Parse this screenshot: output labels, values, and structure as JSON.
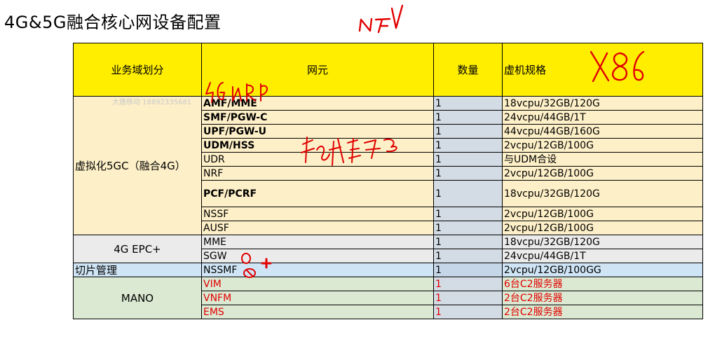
{
  "title": "4G&5G融合核心网设备配置",
  "watermark": "大唐移动 18892335681",
  "handwriting": {
    "top": "NFV",
    "header": "X86",
    "over_element": "5G NR",
    "over_table": "软件功能"
  },
  "table": {
    "headers": {
      "domain": "业务域划分",
      "element": "网元",
      "quantity": "数量",
      "spec": "虚机规格"
    },
    "groups": [
      {
        "domain": "虚拟化5GC（融合4G）",
        "rows": [
          {
            "element": "AMF/MME",
            "quantity": "1",
            "spec": "18vcpu/32GB/120G",
            "bold": true
          },
          {
            "element": "SMF/PGW-C",
            "quantity": "1",
            "spec": "24vcpu/44GB/1T",
            "bold": true
          },
          {
            "element": "UPF/PGW-U",
            "quantity": "1",
            "spec": "44vcpu/44GB/160G",
            "bold": true
          },
          {
            "element": "UDM/HSS",
            "quantity": "1",
            "spec": "2vcpu/12GB/100G",
            "bold": true
          },
          {
            "element": "UDR",
            "quantity": "1",
            "spec": "与UDM合设",
            "bold": false
          },
          {
            "element": "NRF",
            "quantity": "1",
            "spec": "2vcpu/12GB/100G",
            "bold": false
          },
          {
            "element": "PCF/PCRF",
            "quantity": "1",
            "spec": "18vcpu/32GB/120G",
            "bold": true
          },
          {
            "element": "NSSF",
            "quantity": "1",
            "spec": "2vcpu/12GB/100G",
            "bold": false
          },
          {
            "element": "AUSF",
            "quantity": "1",
            "spec": "2vcpu/12GB/100G",
            "bold": false
          }
        ]
      },
      {
        "domain": "4G EPC+",
        "rows": [
          {
            "element": "MME",
            "quantity": "1",
            "spec": "18vcpu/32GB/120G"
          },
          {
            "element": "SGW",
            "quantity": "1",
            "spec": "24vcpu/44GB/1T"
          }
        ]
      },
      {
        "domain": "切片管理",
        "rows": [
          {
            "element": "NSSMF",
            "quantity": "1",
            "spec": "2vcpu/12GB/100GG"
          }
        ]
      },
      {
        "domain": "MANO",
        "rows": [
          {
            "element": "VIM",
            "quantity": "1",
            "spec": "6台C2服务器"
          },
          {
            "element": "VNFM",
            "quantity": "1",
            "spec": "2台C2服务器"
          },
          {
            "element": "EMS",
            "quantity": "1",
            "spec": "2台C2服务器"
          }
        ]
      }
    ]
  },
  "colors": {
    "header": "#ffee00",
    "core_5gc": "#fdefc7",
    "epc": "#ebebeb",
    "slice": "#cfe5f5",
    "mano": "#dbe9d2",
    "mano_text": "#e00000",
    "handwriting": "#e00000"
  }
}
